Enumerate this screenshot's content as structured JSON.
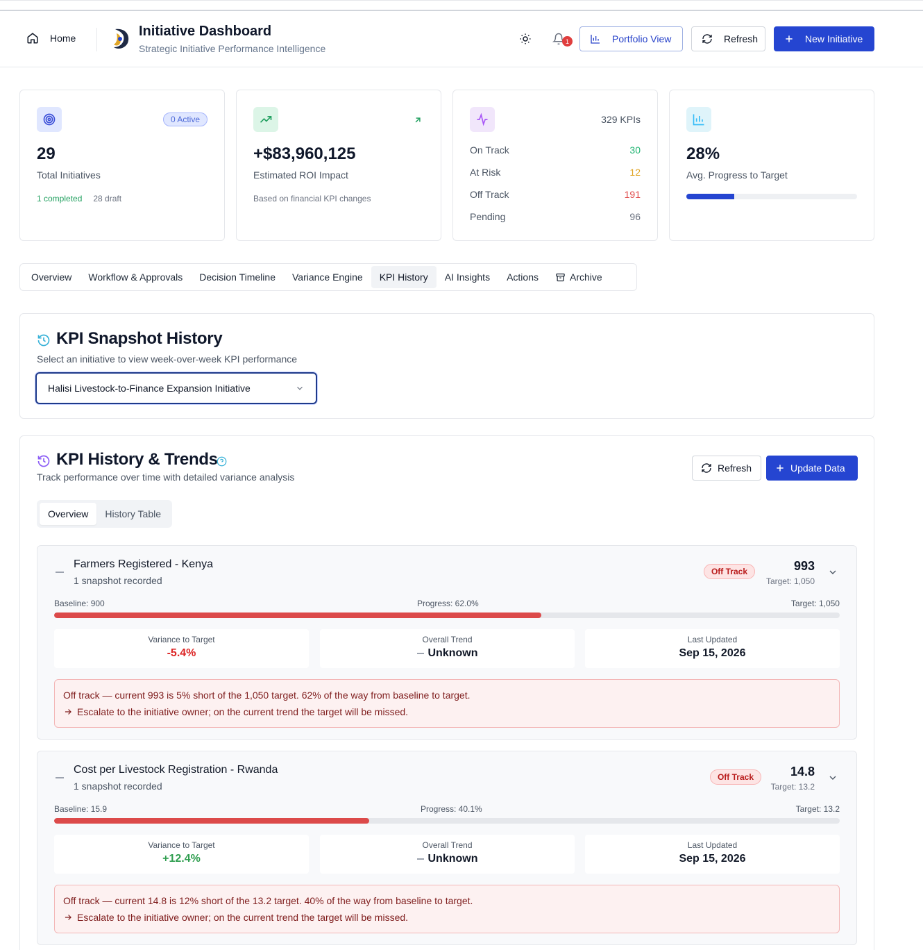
{
  "header": {
    "home_label": "Home",
    "title": "Initiative Dashboard",
    "subtitle": "Strategic Initiative Performance Intelligence",
    "notification_count": "1",
    "portfolio_label": "Portfolio View",
    "refresh_label": "Refresh",
    "new_initiative_label": "New Initiative"
  },
  "cards": {
    "initiatives": {
      "value": "29",
      "label": "Total Initiatives",
      "active_badge": "0 Active",
      "completed": "1 completed",
      "draft": "28 draft"
    },
    "roi": {
      "value": "+$83,960,125",
      "label": "Estimated ROI Impact",
      "note": "Based on financial KPI changes"
    },
    "kpis": {
      "total": "329 KPIs",
      "rows": [
        {
          "label": "On Track",
          "value": "30",
          "color": "#22b573"
        },
        {
          "label": "At Risk",
          "value": "12",
          "color": "#e0a526"
        },
        {
          "label": "Off Track",
          "value": "191",
          "color": "#e04b4b"
        },
        {
          "label": "Pending",
          "value": "96",
          "color": "#6b7280"
        }
      ]
    },
    "progress": {
      "value": "28%",
      "label": "Avg. Progress to Target",
      "fraction": 0.28
    }
  },
  "tabs": [
    {
      "label": "Overview"
    },
    {
      "label": "Workflow & Approvals"
    },
    {
      "label": "Decision Timeline"
    },
    {
      "label": "Variance Engine"
    },
    {
      "label": "KPI History",
      "active": true
    },
    {
      "label": "AI Insights"
    },
    {
      "label": "Actions"
    },
    {
      "label": "Archive"
    }
  ],
  "snapshot": {
    "title": "KPI Snapshot History",
    "subtitle": "Select an initiative to view week-over-week KPI performance",
    "selected_initiative": "Halisi Livestock-to-Finance Expansion Initiative"
  },
  "trends": {
    "title": "KPI History & Trends",
    "subtitle": "Track performance over time with detailed variance analysis",
    "refresh_label": "Refresh",
    "update_label": "Update Data",
    "seg_overview": "Overview",
    "seg_history": "History Table",
    "kpis": [
      {
        "name": "Farmers Registered - Kenya",
        "snapshots": "1 snapshot recorded",
        "status": "Off Track",
        "value": "993",
        "target_small": "Target: 1,050",
        "baseline": "Baseline: 900",
        "progress_text": "Progress: 62.0%",
        "target_line": "Target: 1,050",
        "progress": 0.62,
        "variance_label": "Variance to Target",
        "variance": "-5.4%",
        "variance_color": "#dc2626",
        "trend_label": "Overall Trend",
        "trend": "Unknown",
        "updated_label": "Last Updated",
        "updated": "Sep 15, 2026",
        "alert": "Off track — current 993 is 5% short of the 1,050 target. 62% of the way from baseline to target.",
        "action": "Escalate to the initiative owner; on the current trend the target will be missed."
      },
      {
        "name": "Cost per Livestock Registration - Rwanda",
        "snapshots": "1 snapshot recorded",
        "status": "Off Track",
        "value": "14.8",
        "target_small": "Target: 13.2",
        "baseline": "Baseline: 15.9",
        "progress_text": "Progress: 40.1%",
        "target_line": "Target: 13.2",
        "progress": 0.401,
        "variance_label": "Variance to Target",
        "variance": "+12.4%",
        "variance_color": "#2f9e4f",
        "trend_label": "Overall Trend",
        "trend": "Unknown",
        "updated_label": "Last Updated",
        "updated": "Sep 15, 2026",
        "alert": "Off track — current 14.8 is 12% short of the 13.2 target. 40% of the way from baseline to target.",
        "action": "Escalate to the initiative owner; on the current trend the target will be missed."
      }
    ]
  }
}
